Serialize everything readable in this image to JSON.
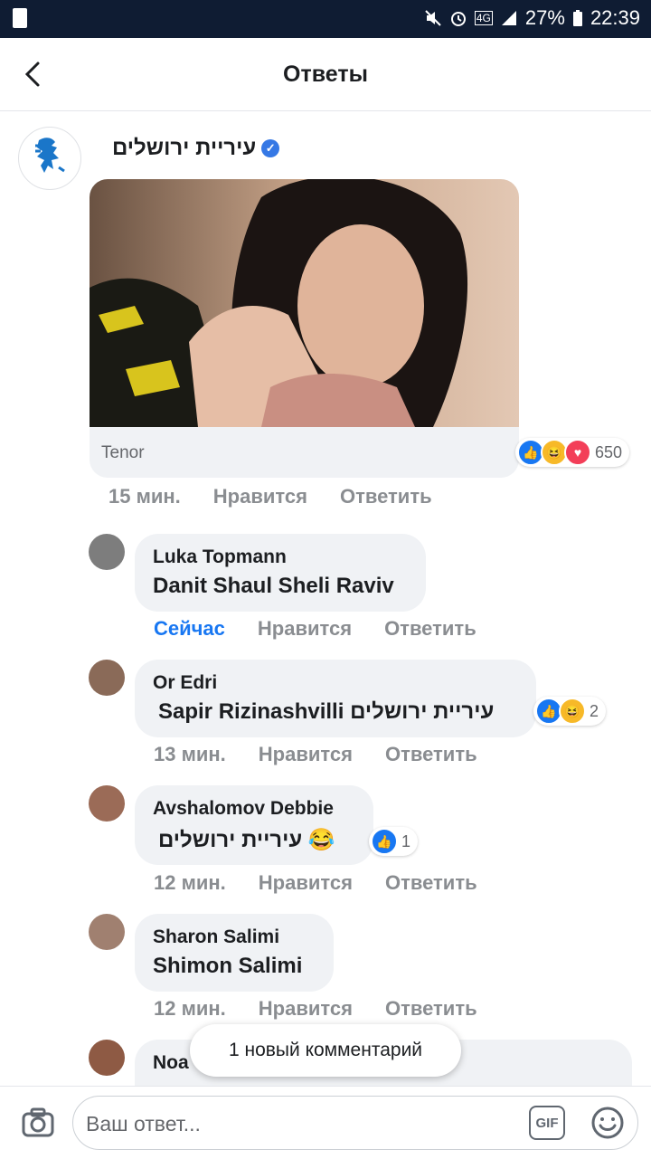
{
  "status_bar": {
    "battery": "27%",
    "time": "22:39",
    "network": "4G"
  },
  "header": {
    "title": "Ответы"
  },
  "main_comment": {
    "author": "עיריית ירושלים",
    "gif_source": "Tenor",
    "reaction_count": "650",
    "time": "15 мин.",
    "like": "Нравится",
    "reply": "Ответить"
  },
  "replies": [
    {
      "name": "Luka Topmann",
      "text": "Danit Shaul Sheli Raviv",
      "time": "Сейчас",
      "like": "Нравится",
      "reply": "Ответить"
    },
    {
      "name": "Or Edri",
      "text": "Sapir Rizinashvilli עיריית ירושלים",
      "reactions": "2",
      "time": "13 мин.",
      "like": "Нравится",
      "reply": "Ответить"
    },
    {
      "name": "Avshalomov Debbie",
      "text": "עיריית ירושלים 😂",
      "reactions": "1",
      "time": "12 мин.",
      "like": "Нравится",
      "reply": "Ответить"
    },
    {
      "name": "Sharon Salimi",
      "text": "Shimon Salimi",
      "time": "12 мин.",
      "like": "Нравится",
      "reply": "Ответить"
    },
    {
      "name": "Noa"
    }
  ],
  "toast": "1 новый комментарий",
  "composer": {
    "placeholder": "Ваш ответ...",
    "gif_label": "GIF"
  },
  "icons": {
    "back": "chevron-left-icon",
    "camera": "camera-icon",
    "emoji": "emoji-icon",
    "verified": "verified-badge-icon"
  }
}
